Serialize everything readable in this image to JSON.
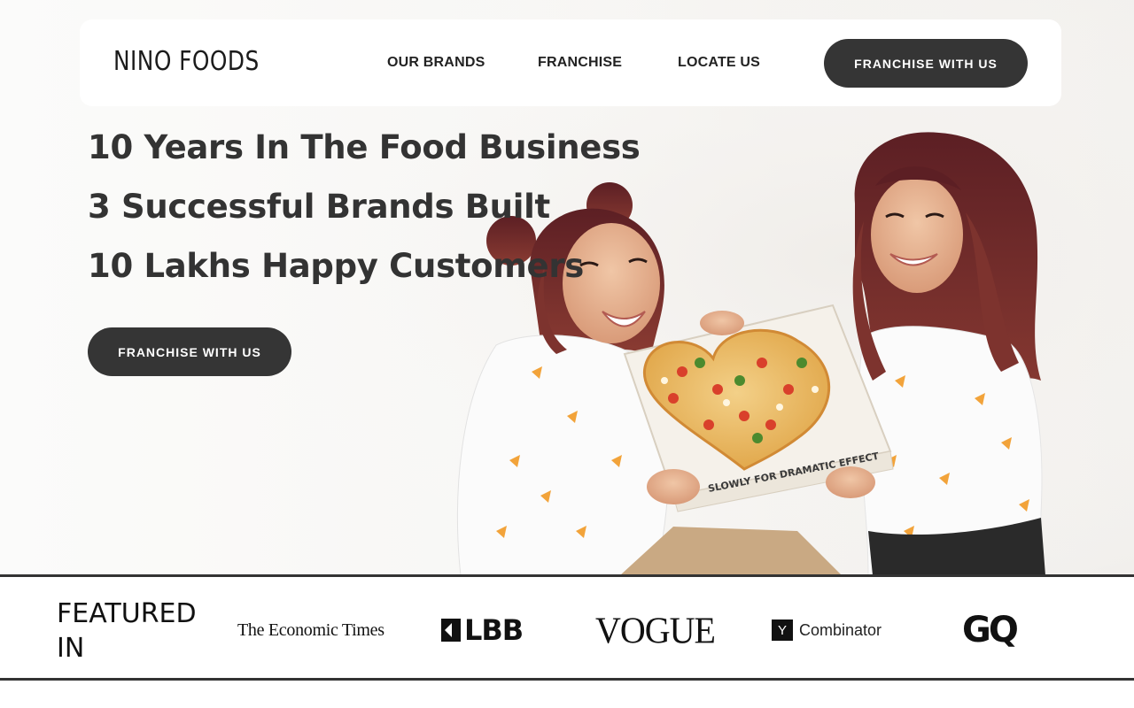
{
  "brand": {
    "logo_text": "NINO FOODS"
  },
  "nav": {
    "links": [
      "OUR BRANDS",
      "FRANCHISE",
      "LOCATE US"
    ],
    "cta_label": "FRANCHISE WITH US"
  },
  "hero": {
    "lines": [
      "10 Years In The Food Business",
      "3 Successful Brands Built",
      "10 Lakhs Happy Customers"
    ],
    "cta_label": "FRANCHISE WITH US",
    "pizza_box_text": "SLOWLY FOR DRAMATIC EFFECT"
  },
  "featured": {
    "label_line1": "FEATURED",
    "label_line2": "IN",
    "outlets": [
      "The Economic Times",
      "LBB",
      "VOGUE",
      "Combinator",
      "GQ"
    ],
    "yc_mark": "Y"
  },
  "colors": {
    "button_bg": "#353535",
    "text_dark": "#333333",
    "hair": "#7a2d2b",
    "shirt": "#ffffff",
    "pizza": "#e9b04d"
  }
}
